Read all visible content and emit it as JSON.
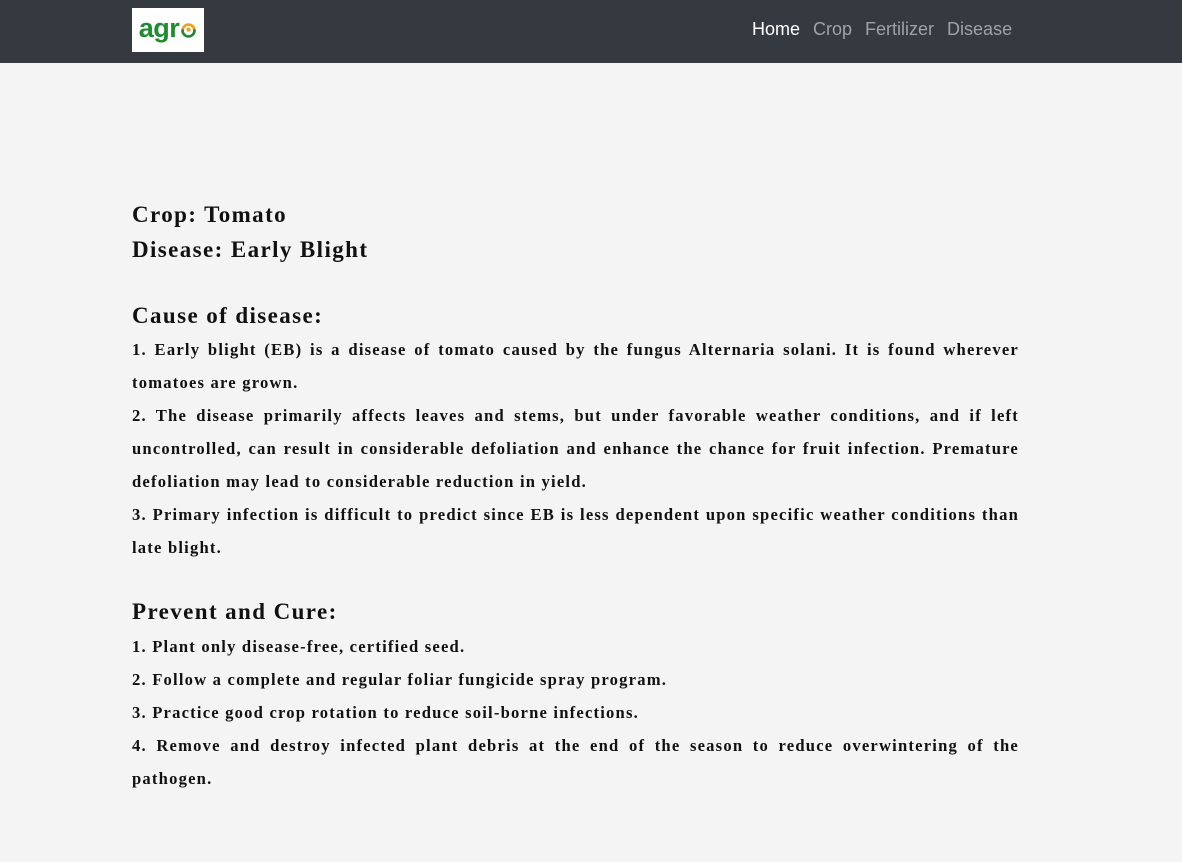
{
  "navbar": {
    "logo_text": "agr",
    "links": [
      {
        "label": "Home",
        "active": true
      },
      {
        "label": "Crop",
        "active": false
      },
      {
        "label": "Fertilizer",
        "active": false
      },
      {
        "label": "Disease",
        "active": false
      }
    ]
  },
  "main": {
    "crop_line": "Crop: Tomato",
    "disease_line": "Disease: Early Blight",
    "cause": {
      "title": "Cause of disease:",
      "items": [
        "1. Early blight (EB) is a disease of tomato caused by the fungus Alternaria solani. It is found wherever tomatoes are grown.",
        "2. The disease primarily affects leaves and stems, but under favorable weather conditions, and if left uncontrolled, can result in considerable defoliation and enhance the chance for fruit infection. Premature defoliation may lead to considerable reduction in yield.",
        "3. Primary infection is difficult to predict since EB is less dependent upon specific weather conditions than late blight."
      ]
    },
    "prevent": {
      "title": "Prevent and Cure:",
      "items": [
        "1. Plant only disease-free, certified seed.",
        "2. Follow a complete and regular foliar fungicide spray program.",
        "3. Practice good crop rotation to reduce soil-borne infections.",
        "4. Remove and destroy infected plant debris at the end of the season to reduce overwintering of the pathogen."
      ]
    }
  },
  "colors": {
    "navbar_bg": "#343a40",
    "page_bg": "#f4f4f4",
    "logo_green": "#1e8c2f",
    "logo_orange": "#f0a020"
  }
}
